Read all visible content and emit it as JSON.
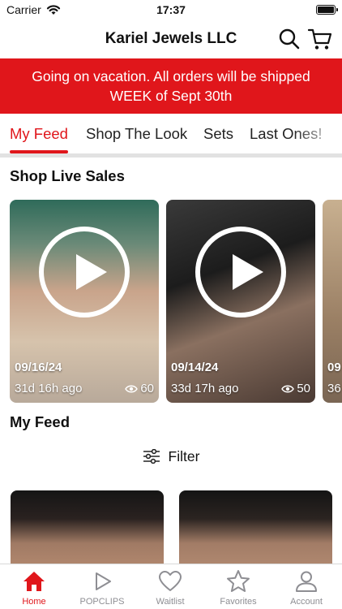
{
  "status_bar": {
    "carrier": "Carrier",
    "time": "17:37"
  },
  "header": {
    "title": "Kariel Jewels LLC"
  },
  "banner": {
    "line1": "Going on vacation. All orders will be shipped",
    "line2": "WEEK of Sept 30th"
  },
  "tabs": [
    {
      "label": "My Feed"
    },
    {
      "label": "Shop The Look"
    },
    {
      "label": "Sets"
    },
    {
      "label": "Last Ones!"
    }
  ],
  "live_sales": {
    "title": "Shop Live Sales",
    "cards": [
      {
        "date": "09/16/24",
        "ago": "31d 16h ago",
        "views": "60"
      },
      {
        "date": "09/14/24",
        "ago": "33d 17h ago",
        "views": "50"
      },
      {
        "date": "09",
        "ago": "36"
      }
    ]
  },
  "feed": {
    "title": "My Feed",
    "filter_label": "Filter"
  },
  "tab_bar": {
    "items": [
      {
        "label": "Home"
      },
      {
        "label": "POPCLIPS"
      },
      {
        "label": "Waitlist"
      },
      {
        "label": "Favorites"
      },
      {
        "label": "Account"
      }
    ]
  },
  "colors": {
    "accent": "#e0161b",
    "inactive": "#8e8e93"
  },
  "icons": [
    "wifi-icon",
    "battery-icon",
    "search-icon",
    "cart-icon",
    "play-icon",
    "eye-icon",
    "filter-icon",
    "home-icon",
    "popclips-icon",
    "heart-icon",
    "star-icon",
    "account-icon"
  ]
}
